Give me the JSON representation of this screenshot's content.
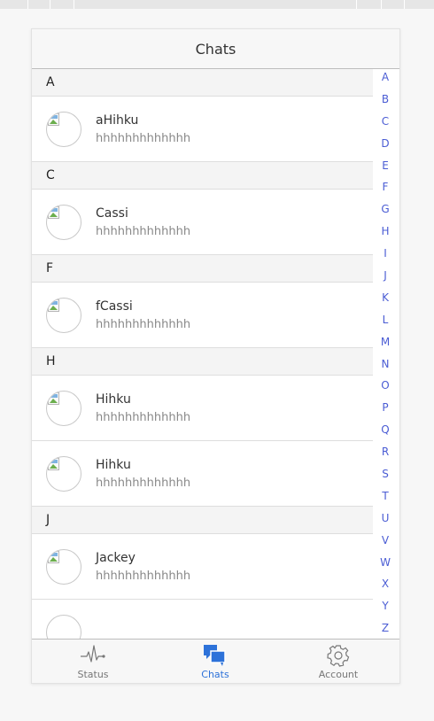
{
  "header": {
    "title": "Chats"
  },
  "sections": [
    {
      "letter": "A",
      "items": [
        {
          "name": "aHihku",
          "message": "hhhhhhhhhhhhh"
        }
      ]
    },
    {
      "letter": "C",
      "items": [
        {
          "name": "Cassi",
          "message": "hhhhhhhhhhhhh"
        }
      ]
    },
    {
      "letter": "F",
      "items": [
        {
          "name": "fCassi",
          "message": "hhhhhhhhhhhhh"
        }
      ]
    },
    {
      "letter": "H",
      "items": [
        {
          "name": "Hihku",
          "message": "hhhhhhhhhhhhh"
        },
        {
          "name": "Hihku",
          "message": "hhhhhhhhhhhhh"
        }
      ]
    },
    {
      "letter": "J",
      "items": [
        {
          "name": "Jackey",
          "message": "hhhhhhhhhhhhh"
        }
      ]
    }
  ],
  "index_letters": [
    "A",
    "B",
    "C",
    "D",
    "E",
    "F",
    "G",
    "H",
    "I",
    "J",
    "K",
    "L",
    "M",
    "N",
    "O",
    "P",
    "Q",
    "R",
    "S",
    "T",
    "U",
    "V",
    "W",
    "X",
    "Y",
    "Z"
  ],
  "tabs": [
    {
      "label": "Status",
      "icon": "pulse-icon"
    },
    {
      "label": "Chats",
      "icon": "chat-bubbles-icon",
      "active": true
    },
    {
      "label": "Account",
      "icon": "gear-icon"
    }
  ],
  "colors": {
    "accent": "#2d72d9",
    "index_text": "#4a5cd4",
    "section_bg": "#f4f4f4"
  }
}
